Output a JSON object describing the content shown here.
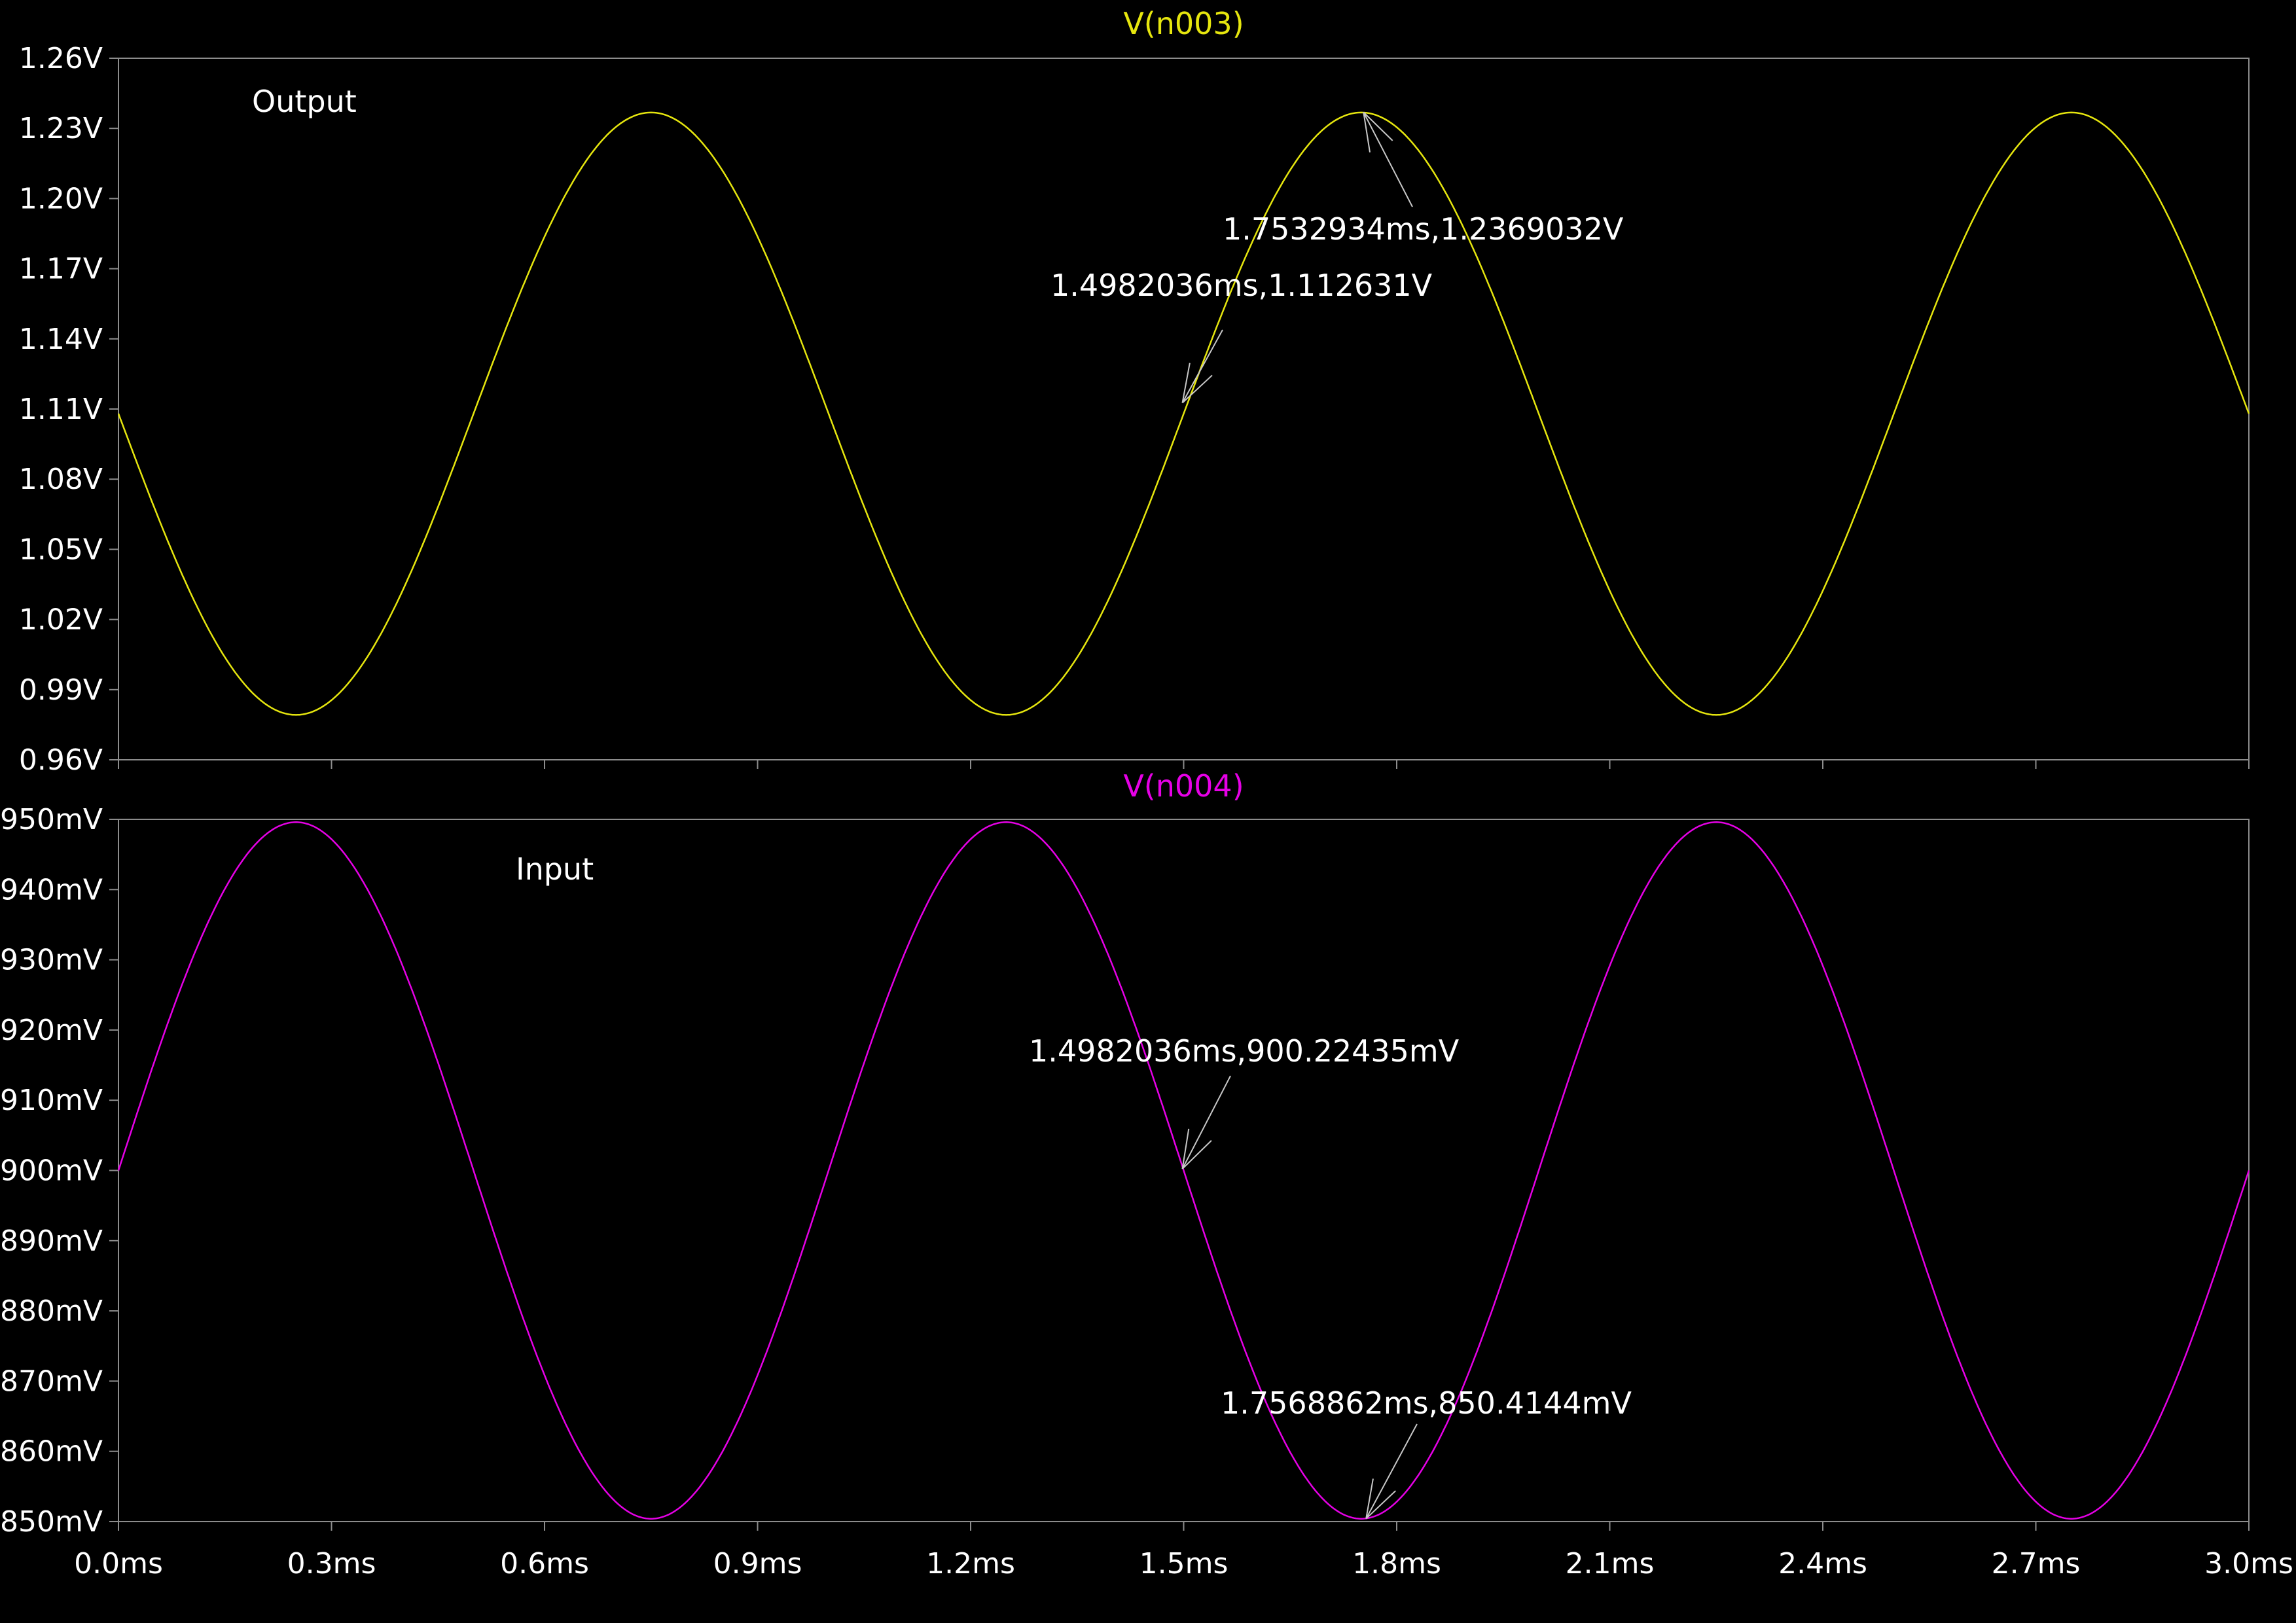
{
  "chart_data": [
    {
      "type": "line",
      "title": "V(n003)",
      "label": "Output",
      "color": "#e6e60e",
      "ylim": [
        0.96,
        1.26
      ],
      "y_ticks": [
        0.96,
        0.99,
        1.02,
        1.05,
        1.08,
        1.11,
        1.14,
        1.17,
        1.2,
        1.23,
        1.26
      ],
      "y_tick_labels": [
        "0.96V",
        "0.99V",
        "1.02V",
        "1.05V",
        "1.08V",
        "1.11V",
        "1.14V",
        "1.17V",
        "1.20V",
        "1.23V",
        "1.26V"
      ],
      "series": [
        {
          "name": "V(n003)",
          "waveform": "sine",
          "offset": 1.108,
          "amplitude": 0.1288,
          "frequency_hz": 1000,
          "phase": "inverted",
          "x_range_ms": [
            0.0,
            3.0
          ]
        }
      ],
      "annotations": [
        {
          "text": "1.7532934ms,1.2369032V",
          "x": 1.7532934,
          "y": 1.2369032
        },
        {
          "text": "1.4982036ms,1.112631V",
          "x": 1.4982036,
          "y": 1.112631
        }
      ]
    },
    {
      "type": "line",
      "title": "V(n004)",
      "label": "Input",
      "color": "#e600e6",
      "ylim": [
        0.85,
        0.95
      ],
      "y_ticks": [
        0.85,
        0.86,
        0.87,
        0.88,
        0.89,
        0.9,
        0.91,
        0.92,
        0.93,
        0.94,
        0.95
      ],
      "y_tick_labels": [
        "850mV",
        "860mV",
        "870mV",
        "880mV",
        "890mV",
        "900mV",
        "910mV",
        "920mV",
        "930mV",
        "940mV",
        "950mV"
      ],
      "series": [
        {
          "name": "V(n004)",
          "waveform": "sine",
          "offset": 0.9,
          "amplitude": 0.0496,
          "frequency_hz": 1000,
          "phase": "normal",
          "x_range_ms": [
            0.0,
            3.0
          ]
        }
      ],
      "annotations": [
        {
          "text": "1.4982036ms,900.22435mV",
          "x": 1.4982036,
          "y": 0.90022435
        },
        {
          "text": "1.7568862ms,850.4144mV",
          "x": 1.7568862,
          "y": 0.8504144
        }
      ]
    }
  ],
  "x_axis": {
    "xlim": [
      0.0,
      3.0
    ],
    "ticks": [
      0.0,
      0.3,
      0.6,
      0.9,
      1.2,
      1.5,
      1.8,
      2.1,
      2.4,
      2.7,
      3.0
    ],
    "tick_labels": [
      "0.0ms",
      "0.3ms",
      "0.6ms",
      "0.9ms",
      "1.2ms",
      "1.5ms",
      "1.8ms",
      "2.1ms",
      "2.4ms",
      "2.7ms",
      "3.0ms"
    ]
  },
  "grid": false,
  "background": "#000000",
  "axis_color": "#8c8c8c",
  "text_color": "#ffffff",
  "annotation_arrow_color": "#c8c8c8"
}
